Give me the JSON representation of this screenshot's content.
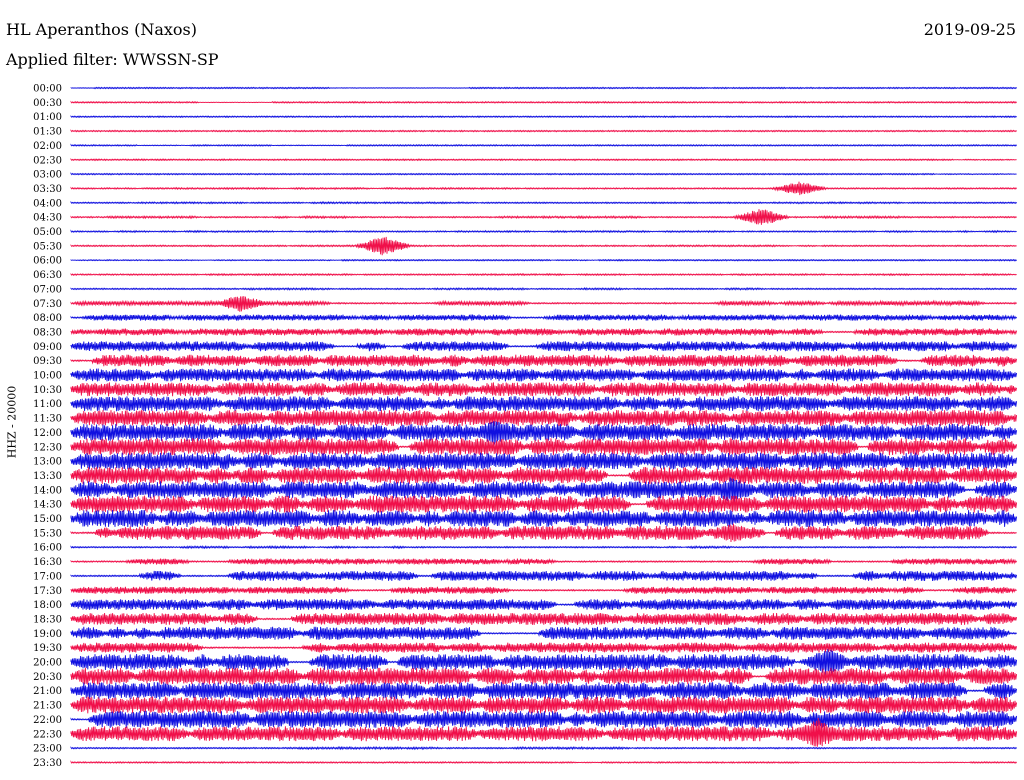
{
  "header": {
    "station": "HL Aperanthos (Naxos)",
    "date": "2019-09-25",
    "filter": "Applied filter: WWSSN-SP"
  },
  "chart_data": {
    "type": "line",
    "title": "HL Aperanthos (Naxos)",
    "subtitle": "Applied filter: WWSSN-SP",
    "ylabel": "HHZ - 20000",
    "xlabel": "",
    "colors": [
      "#1010e0",
      "#f0104a"
    ],
    "grid": false,
    "legend": "none",
    "time_labels": [
      "00:00",
      "00:30",
      "01:00",
      "01:30",
      "02:00",
      "02:30",
      "03:00",
      "03:30",
      "04:00",
      "04:30",
      "05:00",
      "05:30",
      "06:00",
      "06:30",
      "07:00",
      "07:30",
      "08:00",
      "08:30",
      "09:00",
      "09:30",
      "10:00",
      "10:30",
      "11:00",
      "11:30",
      "12:00",
      "12:30",
      "13:00",
      "13:30",
      "14:00",
      "14:30",
      "15:00",
      "15:30",
      "16:00",
      "16:30",
      "17:00",
      "17:30",
      "18:00",
      "18:30",
      "19:00",
      "19:30",
      "20:00",
      "20:30",
      "21:00",
      "21:30",
      "22:00",
      "22:30",
      "23:00",
      "23:30"
    ],
    "trace_amplitude": [
      0.3,
      0.3,
      0.3,
      0.3,
      0.4,
      0.5,
      0.5,
      0.8,
      0.8,
      1.0,
      0.8,
      0.8,
      0.5,
      0.8,
      0.9,
      2.0,
      3.0,
      3.5,
      5.0,
      6.0,
      6.5,
      7.0,
      7.5,
      8.0,
      8.5,
      8.5,
      8.5,
      8.5,
      8.5,
      8.5,
      8.5,
      7.0,
      1.0,
      3.0,
      5.0,
      3.5,
      5.5,
      6.0,
      6.5,
      5.0,
      8.0,
      8.5,
      8.5,
      8.5,
      8.5,
      7.5,
      1.0,
      0.5
    ],
    "trace_activity": [
      0.05,
      0.05,
      0.05,
      0.05,
      0.1,
      0.1,
      0.1,
      0.2,
      0.2,
      0.3,
      0.3,
      0.3,
      0.1,
      0.3,
      0.3,
      0.5,
      0.7,
      0.8,
      0.9,
      0.9,
      0.9,
      0.9,
      0.9,
      0.95,
      0.95,
      0.95,
      0.95,
      0.95,
      0.95,
      0.95,
      0.95,
      0.7,
      0.2,
      0.5,
      0.8,
      0.6,
      0.8,
      0.8,
      0.8,
      0.7,
      0.95,
      0.95,
      0.95,
      0.95,
      0.95,
      0.9,
      0.1,
      0.05
    ],
    "events": [
      {
        "row": 7,
        "at": 0.77,
        "amp": 7
      },
      {
        "row": 9,
        "at": 0.73,
        "amp": 9
      },
      {
        "row": 11,
        "at": 0.33,
        "amp": 10
      },
      {
        "row": 15,
        "at": 0.18,
        "amp": 9
      },
      {
        "row": 24,
        "at": 0.45,
        "amp": 14
      },
      {
        "row": 28,
        "at": 0.7,
        "amp": 14
      },
      {
        "row": 31,
        "at": 0.7,
        "amp": 10
      },
      {
        "row": 40,
        "at": 0.8,
        "amp": 14
      },
      {
        "row": 45,
        "at": 0.79,
        "amp": 16
      }
    ]
  }
}
